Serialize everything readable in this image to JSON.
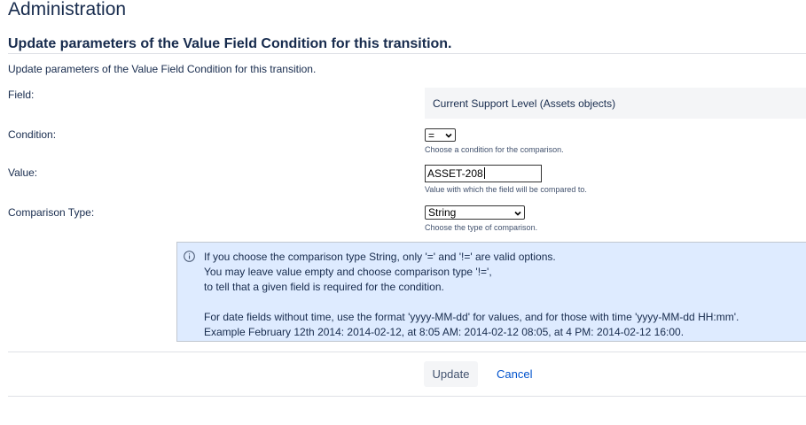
{
  "header": {
    "title": "Administration"
  },
  "form": {
    "heading": "Update parameters of the Value Field Condition for this transition.",
    "description": "Update parameters of the Value Field Condition for this transition.",
    "field": {
      "label": "Field:",
      "value": "Current Support Level (Assets objects)"
    },
    "condition": {
      "label": "Condition:",
      "selected": "=",
      "help": "Choose a condition for the comparison."
    },
    "value": {
      "label": "Value:",
      "current": "ASSET-208",
      "help": "Value with which the field will be compared to."
    },
    "comparison_type": {
      "label": "Comparison Type:",
      "selected": "String",
      "help": "Choose the type of comparison."
    }
  },
  "info": {
    "icon": "info-icon",
    "line1": "If you choose the comparison type String, only '=' and '!=' are valid options.",
    "line2": "You may leave value empty and choose comparison type '!=',",
    "line3": "to tell that a given field is required for the condition.",
    "line4": "For date fields without time, use the format 'yyyy-MM-dd' for values, and for those with time 'yyyy-MM-dd HH:mm'.",
    "line5": "Example February 12th 2014: 2014-02-12, at 8:05 AM: 2014-02-12 08:05, at 4 PM: 2014-02-12 16:00."
  },
  "actions": {
    "update_label": "Update",
    "cancel_label": "Cancel"
  },
  "colors": {
    "info_background": "#deebff",
    "link": "#0052cc",
    "text": "#172b4d"
  }
}
